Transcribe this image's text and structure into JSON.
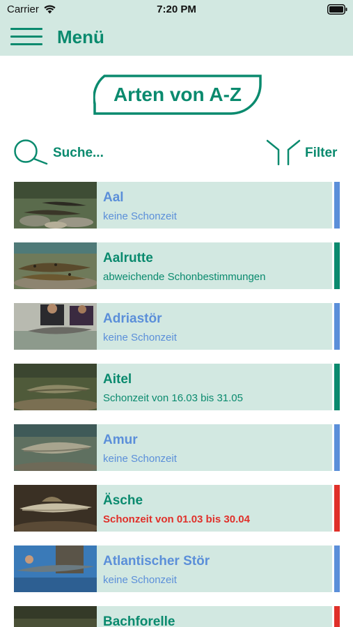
{
  "status_bar": {
    "carrier": "Carrier",
    "time": "7:20 PM"
  },
  "nav": {
    "title": "Menü",
    "menu_icon": "hamburger-icon"
  },
  "header": {
    "title": "Arten von A-Z"
  },
  "search": {
    "label": "Suche...",
    "icon": "search-icon"
  },
  "filter": {
    "label": "Filter",
    "icon": "filter-icon"
  },
  "colors": {
    "brand": "#0a8a6e",
    "row_background": "#d2e8e1",
    "blue": "#5b8fd9",
    "green": "#0a8a6e",
    "red": "#e0302a"
  },
  "species": [
    {
      "name": "Aal",
      "season": "keine Schonzeit",
      "status": "blue"
    },
    {
      "name": "Aalrutte",
      "season": "abweichende Schonbestimmungen",
      "status": "green"
    },
    {
      "name": "Adriastör",
      "season": "keine Schonzeit",
      "status": "blue"
    },
    {
      "name": "Aitel",
      "season": "Schonzeit von 16.03 bis 31.05",
      "status": "green"
    },
    {
      "name": "Amur",
      "season": "keine Schonzeit",
      "status": "blue"
    },
    {
      "name": "Äsche",
      "season": "Schonzeit von 01.03 bis 30.04",
      "status": "red"
    },
    {
      "name": "Atlantischer Stör",
      "season": "keine Schonzeit",
      "status": "blue"
    },
    {
      "name": "Bachforelle",
      "season": "",
      "status": "red"
    }
  ]
}
